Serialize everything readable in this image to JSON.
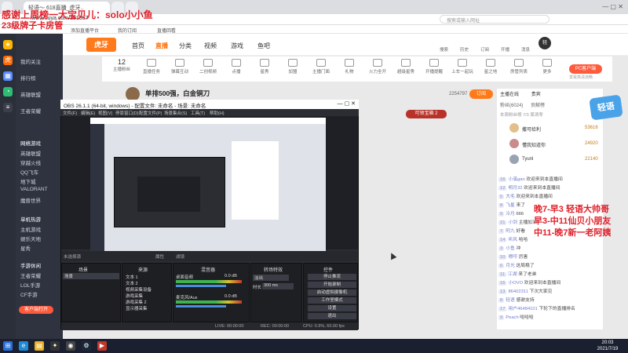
{
  "browser": {
    "tabs": [
      "轻语～ 618直播_虎牙..",
      "",
      "",
      ""
    ],
    "address": "www.huya.com/101367",
    "search_hint": "搜索或输入网址",
    "bookmarks": [
      "添加直播平台",
      "我的订阅",
      "直播回看"
    ]
  },
  "overlay": {
    "top_line1": "感谢上周榜一大宝贝儿：solo小小鱼",
    "top_line2": "23级牌子卡房管",
    "schedule": [
      "晚7-早3 轻语大帅哥",
      "早3-中11仙贝小朋友",
      "中11-晚7新一老阿姨"
    ]
  },
  "sidebar": {
    "items": [
      "我的关注",
      "排行榜",
      "英雄联盟",
      "王者荣耀",
      "网络游戏",
      "英雄联盟",
      "穿越火线",
      "QQ飞车",
      "地下城",
      "VALORANT",
      "魔兽世界",
      "单机热游",
      "主机游戏",
      "娱乐天地",
      "星秀",
      "手游休闲",
      "王者荣耀",
      "LOL手游",
      "CF手游"
    ],
    "client_button": "客户端打开"
  },
  "header": {
    "logo": "虎牙",
    "nav": [
      "首页",
      "直播",
      "分类",
      "视频",
      "游戏",
      "鱼吧"
    ],
    "active_nav": "直播",
    "right_icons": [
      "搜索",
      "历史",
      "订阅",
      "开播",
      "消息"
    ]
  },
  "tools": {
    "level_number": "12",
    "items": [
      "主播粉丝",
      "直播任务",
      "弹幕互动",
      "二创视频",
      "点播",
      "星秀",
      "加盟",
      "主播门面",
      "礼物",
      "火力全开",
      "超级星秀",
      "开播提醒",
      "上车一起玩",
      "星之地",
      "房管列表",
      "更多"
    ],
    "pc_client": "PC客户端",
    "pc_client_sub": "享受高清流畅"
  },
  "stream": {
    "title": "单排500强，白金铜刀",
    "follow_label": "订阅",
    "fans": "2254797",
    "share": "可领宝箱 2"
  },
  "right_panel": {
    "tabs": [
      "主播在线",
      "贵宾",
      "粉丝(6024)",
      "贡献榜"
    ],
    "notice": "本周粉丝榜 7/3 周清零",
    "ranks": [
      {
        "name": "撒可给利",
        "score": "53616"
      },
      {
        "name": "懂我知道你",
        "score": "24920"
      },
      {
        "name": "Tyunl",
        "score": "22140"
      }
    ],
    "chats": [
      {
        "lv": "16",
        "user": "小溪gan",
        "text": "欢迎来到本直播间"
      },
      {
        "lv": "12",
        "user": "明月32",
        "text": "欢迎来到本直播间"
      },
      {
        "lv": "5",
        "user": "大毛",
        "text": "欢迎来到本直播间"
      },
      {
        "lv": "8",
        "user": "飞星",
        "text": "来了"
      },
      {
        "lv": "9",
        "user": "冷月",
        "text": "666"
      },
      {
        "lv": "21",
        "user": "小剑",
        "text": "主播加油"
      },
      {
        "lv": "7",
        "user": "阿九",
        "text": "好看"
      },
      {
        "lv": "14",
        "user": "听风",
        "text": "哈哈"
      },
      {
        "lv": "3",
        "user": "小鱼",
        "text": "冲"
      },
      {
        "lv": "10",
        "user": "嗯哼",
        "text": "厉害"
      },
      {
        "lv": "6",
        "user": "月光",
        "text": "这局稳了"
      },
      {
        "lv": "11",
        "user": "江湖",
        "text": "来了老弟"
      },
      {
        "lv": "16",
        "user": "小OVO",
        "text": "欢迎来到本直播间"
      },
      {
        "lv": "13",
        "user": "86402311",
        "text": "下次大家见"
      },
      {
        "lv": "8",
        "user": "轻语",
        "text": "感谢支持"
      },
      {
        "lv": "17",
        "user": "用户46484101",
        "text": "下轮下的直播排名"
      },
      {
        "lv": "9",
        "user": "Peach",
        "text": "哈哈哈"
      }
    ]
  },
  "obs": {
    "title": "OBS 26.1.1 (64-bit, windows) - 配置文件: 未命名 - 场景: 未命名",
    "menu": [
      "文件(F)",
      "编辑(E)",
      "视图(V)",
      "停靠窗口(D)",
      "配置文件(P)",
      "场景集合(S)",
      "工具(T)",
      "帮助(H)"
    ],
    "source_label": "未选择源",
    "props": "属性",
    "filters": "滤镜",
    "docks": [
      "场景",
      "来源",
      "混音器",
      "转场特效",
      "控件"
    ],
    "scene": "场景",
    "sources": [
      "文本 1",
      "文本 2",
      "视频采集设备",
      "游戏采集",
      "游戏采集 2",
      "显示器采集"
    ],
    "mixer": [
      {
        "name": "桌面音频",
        "db": "0.0 dB"
      },
      {
        "name": "麦克风/Aux",
        "db": "0.0 dB"
      }
    ],
    "transition": "淡出",
    "duration_label": "时长",
    "duration": "300 ms",
    "controls": [
      "停止推流",
      "开始录制",
      "启动虚拟摄像机",
      "工作室模式",
      "设置",
      "退出"
    ],
    "status": {
      "live": "LIVE: 00:00:00",
      "rec": "REC: 00:00:00",
      "cpu": "CPU: 0.9%, 60.00 fps"
    }
  },
  "taskbar": {
    "time": "20:03",
    "date": "2021/7/19"
  }
}
